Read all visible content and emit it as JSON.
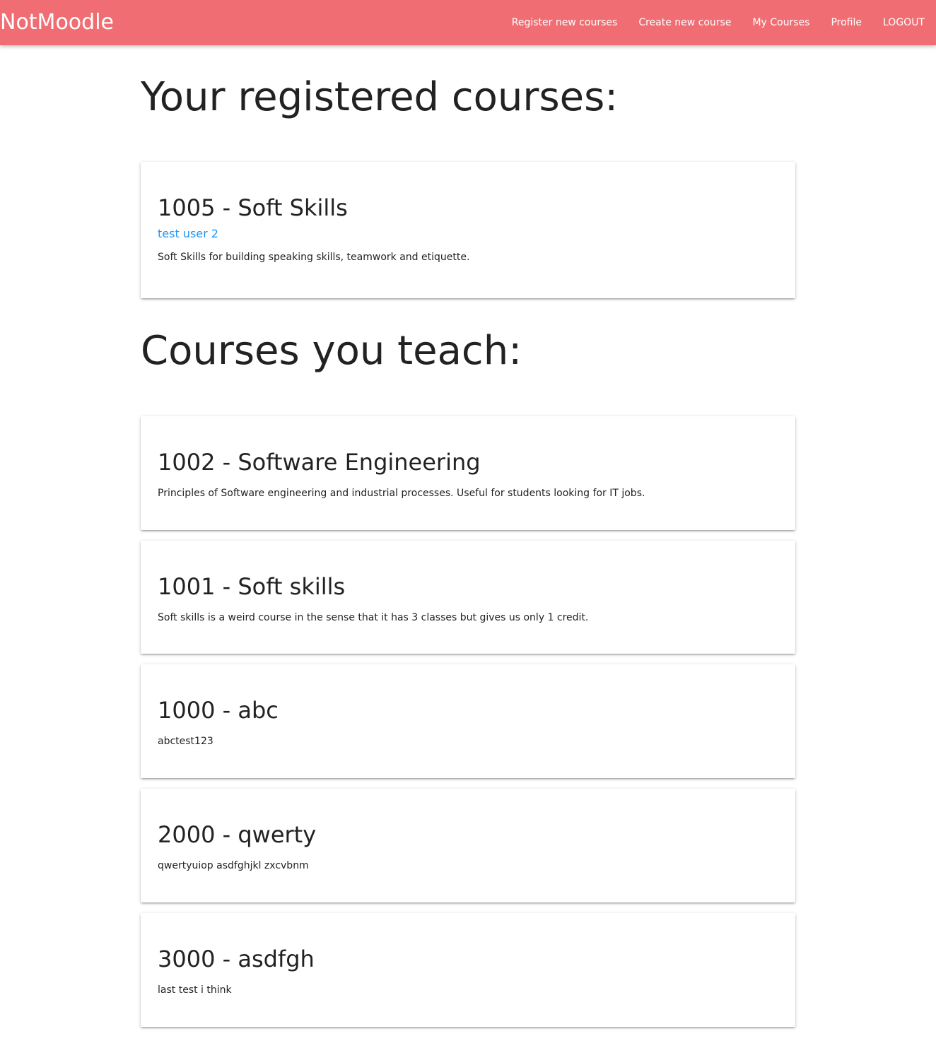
{
  "colors": {
    "navbar": "#f06e73",
    "link": "#2196f3"
  },
  "navbar": {
    "brand": "NotMoodle",
    "links": [
      {
        "label": "Register new courses"
      },
      {
        "label": "Create new course"
      },
      {
        "label": "My Courses"
      },
      {
        "label": "Profile"
      },
      {
        "label": "LOGOUT"
      }
    ]
  },
  "registered": {
    "title": "Your registered courses:",
    "courses": [
      {
        "title": "1005 - Soft Skills",
        "instructor": "test user 2",
        "description": "Soft Skills for building speaking skills, teamwork and etiquette."
      }
    ]
  },
  "teaching": {
    "title": "Courses you teach:",
    "courses": [
      {
        "title": "1002 - Software Engineering",
        "description": "Principles of Software engineering and industrial processes. Useful for students looking for IT jobs."
      },
      {
        "title": "1001 - Soft skills",
        "description": "Soft skills is a weird course in the sense that it has 3 classes but gives us only 1 credit."
      },
      {
        "title": "1000 - abc",
        "description": "abctest123"
      },
      {
        "title": "2000 - qwerty",
        "description": "qwertyuiop asdfghjkl zxcvbnm"
      },
      {
        "title": "3000 - asdfgh",
        "description": "last test i think"
      }
    ]
  }
}
